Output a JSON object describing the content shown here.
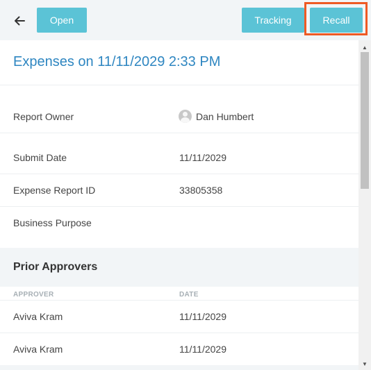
{
  "toolbar": {
    "back_icon": "arrow-left-icon",
    "open_label": "Open",
    "tracking_label": "Tracking",
    "recall_label": "Recall",
    "button_color": "#5bc3d6",
    "highlight_color": "#ee5a24"
  },
  "report": {
    "title": "Expenses on 11/11/2029 2:33 PM",
    "title_color": "#2e86c1",
    "fields": {
      "owner": {
        "label": "Report Owner",
        "value": "Dan Humbert",
        "icon": "user-avatar-icon"
      },
      "submit_date": {
        "label": "Submit Date",
        "value": "11/11/2029"
      },
      "report_id": {
        "label": "Expense Report ID",
        "value": "33805358"
      },
      "business_purpose": {
        "label": "Business Purpose",
        "value": ""
      }
    }
  },
  "prior_approvers": {
    "heading": "Prior Approvers",
    "columns": {
      "approver": "APPROVER",
      "date": "DATE"
    },
    "rows": [
      {
        "name": "Aviva Kram",
        "date": "11/11/2029"
      },
      {
        "name": "Aviva Kram",
        "date": "11/11/2029"
      }
    ]
  },
  "scrollbar": {
    "up_icon": "scroll-up-arrow-icon",
    "down_icon": "scroll-down-arrow-icon"
  }
}
